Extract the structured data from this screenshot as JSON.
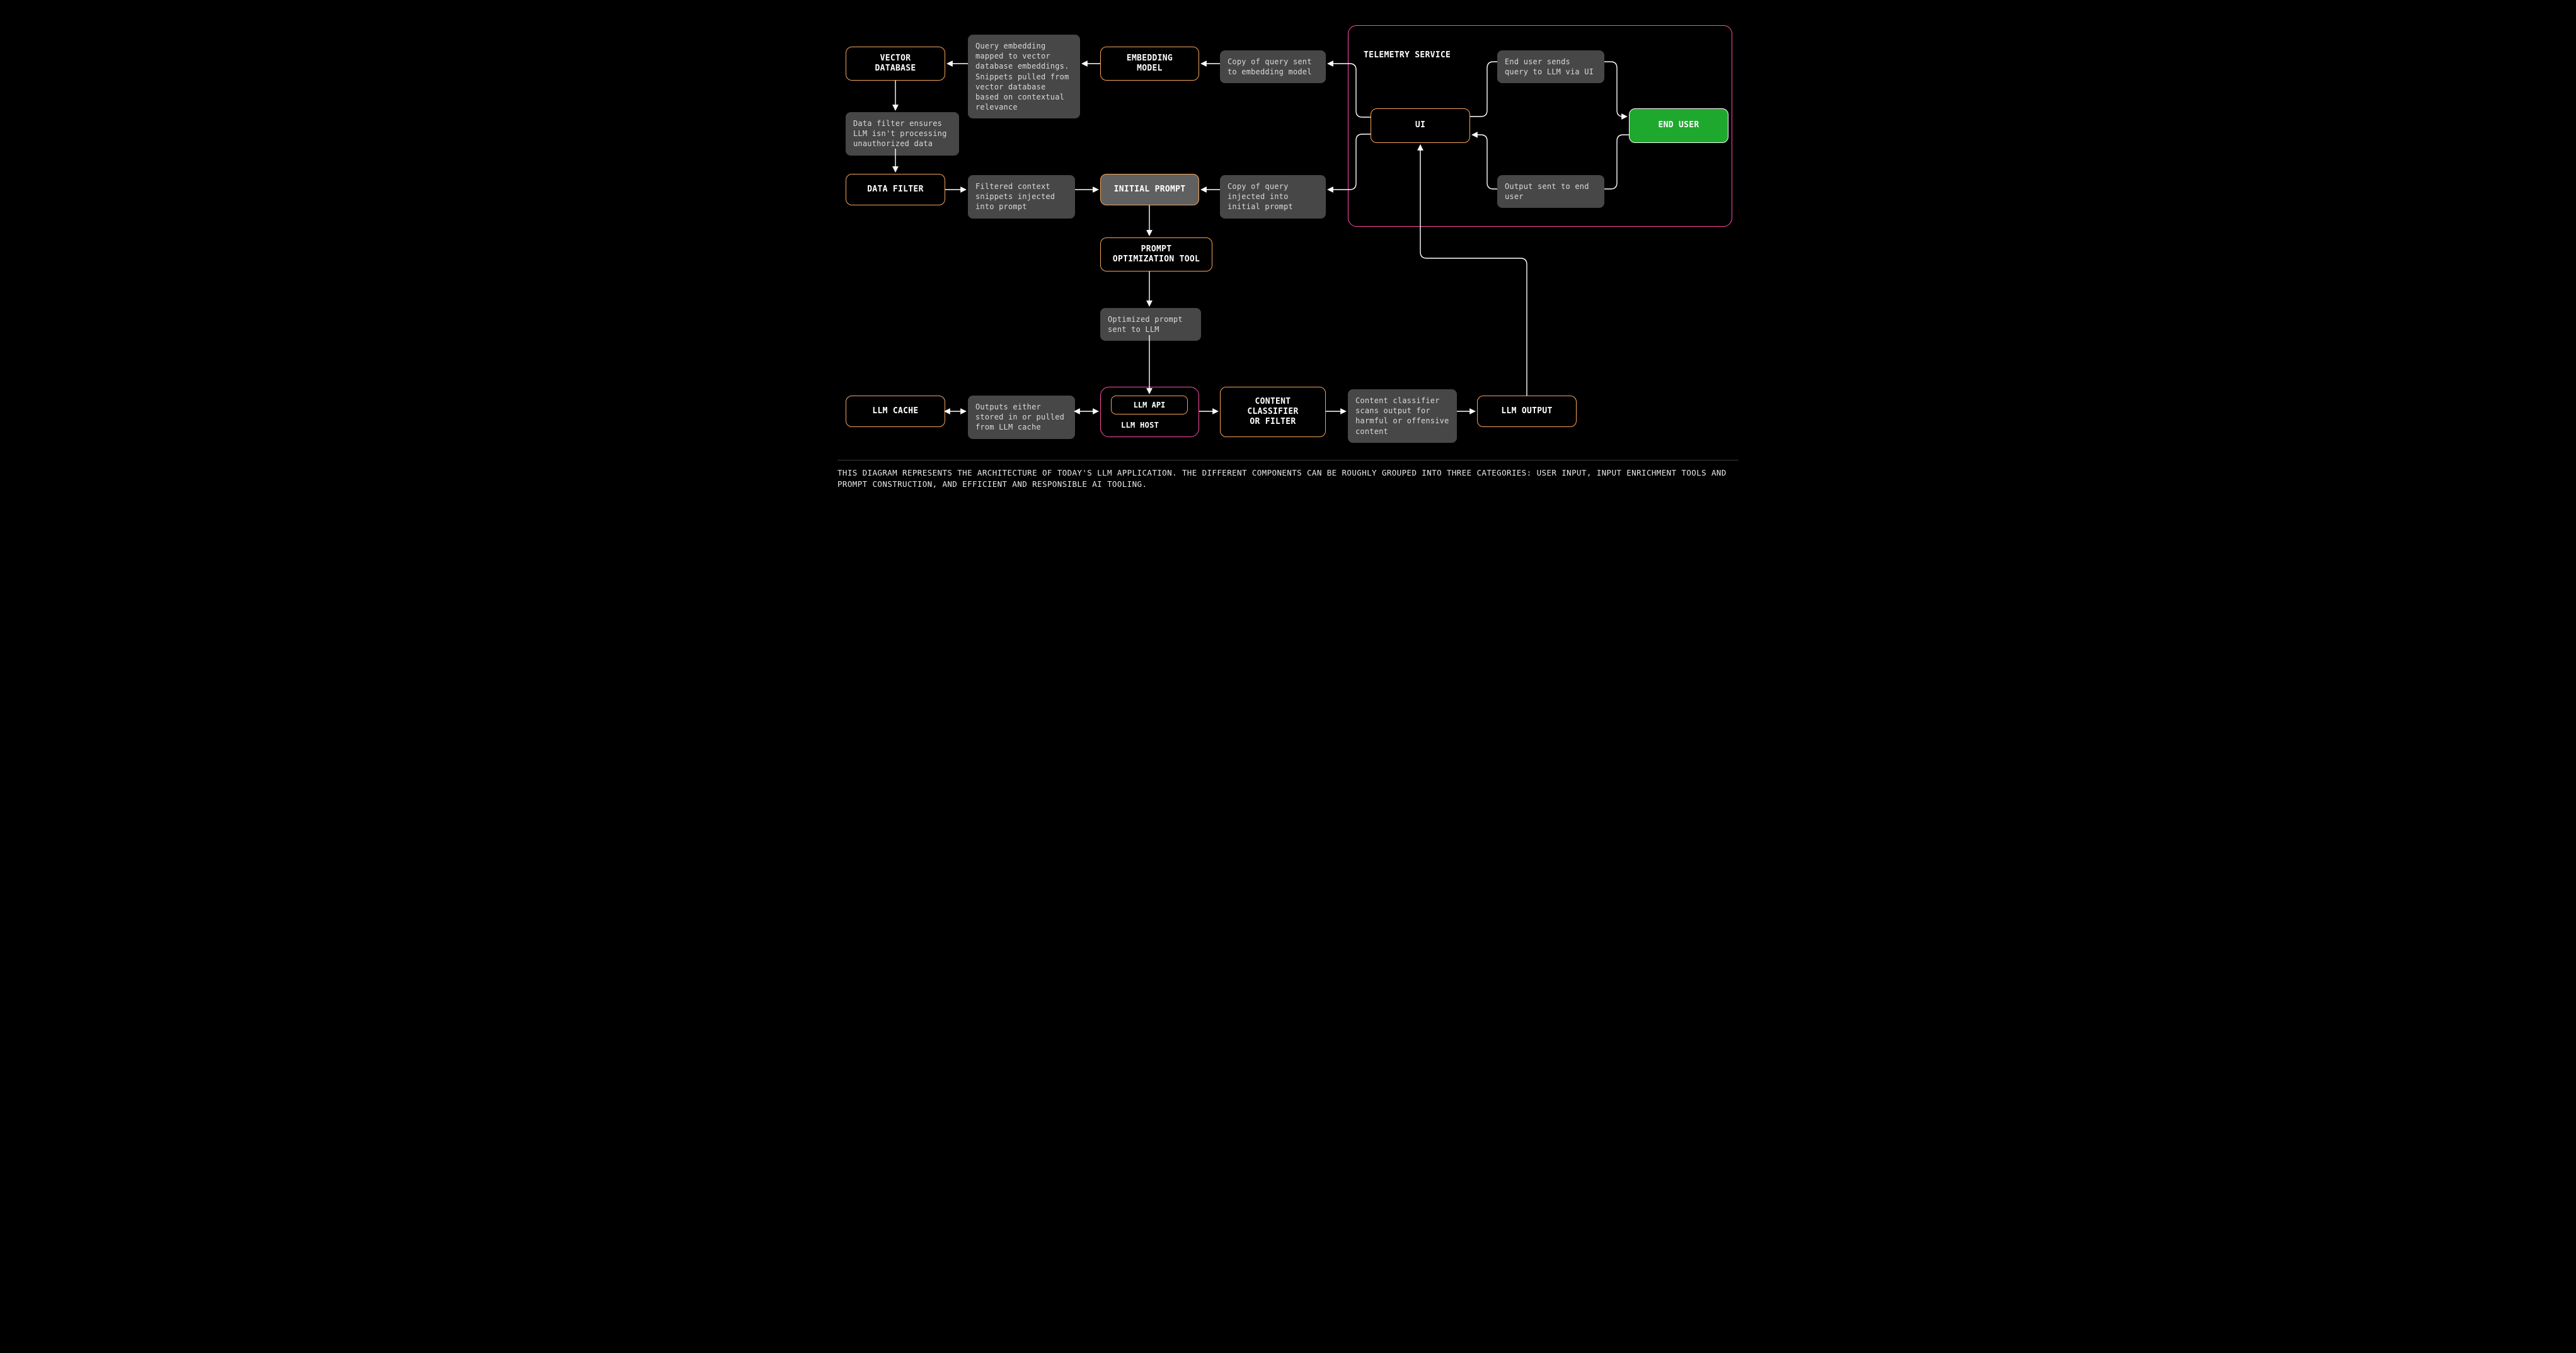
{
  "nodes": {
    "vector_db": "VECTOR\nDATABASE",
    "embedding_model": "EMBEDDING\nMODEL",
    "telemetry_label": "TELEMETRY SERVICE",
    "ui": "UI",
    "end_user": "END USER",
    "data_filter": "DATA FILTER",
    "initial_prompt": "INITIAL PROMPT",
    "prompt_opt": "PROMPT\nOPTIMIZATION TOOL",
    "llm_cache": "LLM CACHE",
    "llm_api": "LLM API",
    "llm_host_label": "LLM  HOST",
    "content_classifier": "CONTENT\nCLASSIFIER\nOR FILTER",
    "llm_output": "LLM OUTPUT"
  },
  "notes": {
    "embed_map": "Query embedding mapped to vector database embeddings. Snippets pulled from vector database based on contextual relevance",
    "copy_to_embed": "Copy of query sent to embedding model",
    "end_user_sends": "End user sends query to LLM via UI",
    "data_filter_note": "Data filter ensures LLM isn't processing unauthorized data",
    "filtered_ctx": "Filtered context snippets injected into prompt",
    "copy_to_prompt": "Copy of query injected into initial prompt",
    "output_to_user": "Output sent to end user",
    "optimized_prompt": "Optimized prompt sent to LLM",
    "outputs_cache": "Outputs either stored in or pulled from LLM cache",
    "classifier_scan": "Content classifier scans output for harmful or offensive content"
  },
  "caption": "THIS DIAGRAM REPRESENTS THE ARCHITECTURE OF TODAY'S LLM APPLICATION. THE DIFFERENT COMPONENTS CAN BE ROUGHLY GROUPED INTO THREE CATEGORIES: USER INPUT, INPUT ENRICHMENT TOOLS AND PROMPT CONSTRUCTION, AND EFFICIENT AND RESPONSIBLE AI TOOLING."
}
